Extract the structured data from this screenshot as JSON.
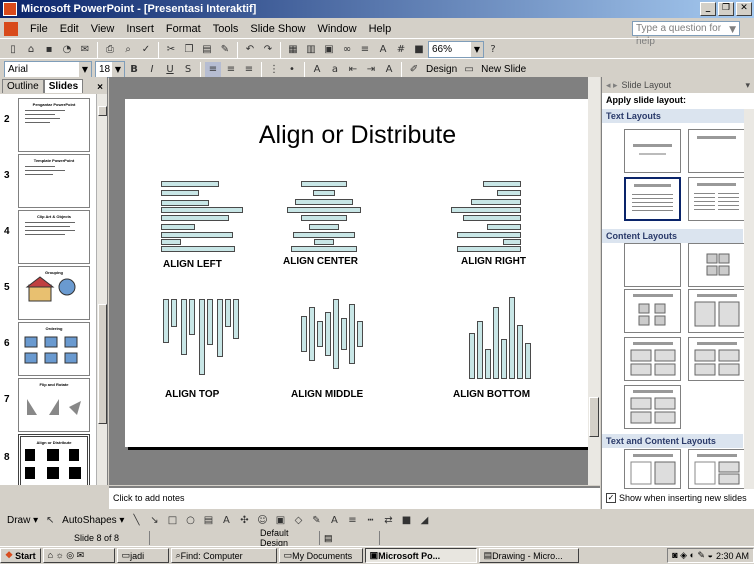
{
  "window": {
    "title": "Microsoft PowerPoint - [Presentasi Interaktif]"
  },
  "menu": {
    "items": [
      "File",
      "Edit",
      "View",
      "Insert",
      "Format",
      "Tools",
      "Slide Show",
      "Window",
      "Help"
    ],
    "help_placeholder": "Type a question for help"
  },
  "toolbar": {
    "zoom": "66%",
    "font": "Arial",
    "font_size": "18",
    "design_label": "Design",
    "new_slide_label": "New Slide"
  },
  "left_pane": {
    "tabs": [
      "Outline",
      "Slides"
    ],
    "close": "×",
    "slides": [
      {
        "num": "2",
        "title": "Pengantar PowerPoint"
      },
      {
        "num": "3",
        "title": "Template PowerPoint"
      },
      {
        "num": "4",
        "title": "Clip Art & Objects"
      },
      {
        "num": "5",
        "title": "Grouping"
      },
      {
        "num": "6",
        "title": "Ordering"
      },
      {
        "num": "7",
        "title": "Flip and Rotate"
      },
      {
        "num": "8",
        "title": "Align or Distribute"
      }
    ]
  },
  "slide": {
    "title": "Align or Distribute",
    "captions": [
      "ALIGN LEFT",
      "ALIGN CENTER",
      "ALIGN RIGHT",
      "ALIGN TOP",
      "ALIGN MIDDLE",
      "ALIGN BOTTOM"
    ]
  },
  "notes": {
    "placeholder": "Click to add notes"
  },
  "task_pane": {
    "header": "Slide Layout",
    "subtitle": "Apply slide layout:",
    "sections": [
      "Text Layouts",
      "Content Layouts",
      "Text and Content Layouts"
    ],
    "show_checkbox": "Show when inserting new slides"
  },
  "draw_toolbar": {
    "draw_label": "Draw",
    "autoshapes_label": "AutoShapes"
  },
  "status": {
    "slide": "Slide 8 of 8",
    "design": "Default Design"
  },
  "taskbar": {
    "start": "Start",
    "items": [
      "jadi",
      "Find: Computer",
      "My Documents",
      "Microsoft Po...",
      "Drawing - Micro..."
    ],
    "time": "2:30 AM"
  }
}
